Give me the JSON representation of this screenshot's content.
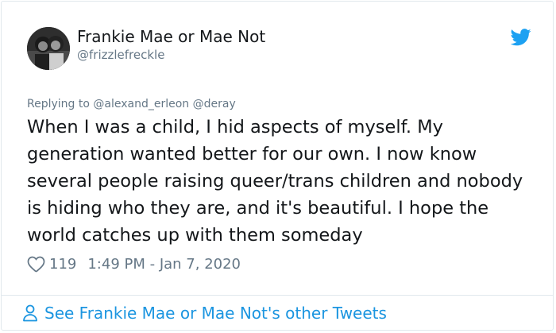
{
  "author": {
    "name": "Frankie Mae or Mae Not",
    "handle": "@frizzlefreckle"
  },
  "reply": {
    "prefix": "Replying to",
    "mentions": [
      "@alexand_erleon",
      "@deray"
    ]
  },
  "tweet": {
    "text": "When I was a child, I hid aspects of myself. My generation wanted better for our own. I now know several people raising queer/trans children and nobody is hiding who they are, and it's beautiful. I hope the world catches up with them someday"
  },
  "stats": {
    "likes": "119",
    "timestamp": "1:49 PM - Jan 7, 2020"
  },
  "footer": {
    "link_text": "See Frankie Mae or Mae Not's other Tweets"
  },
  "icons": {
    "brand": "twitter-bird-icon",
    "like": "heart-icon",
    "profile": "person-icon"
  },
  "colors": {
    "brand_blue": "#1da1f2",
    "link_blue": "#1b95e0",
    "secondary_text": "#657786",
    "primary_text": "#14171a",
    "border": "#e1e8ed"
  }
}
